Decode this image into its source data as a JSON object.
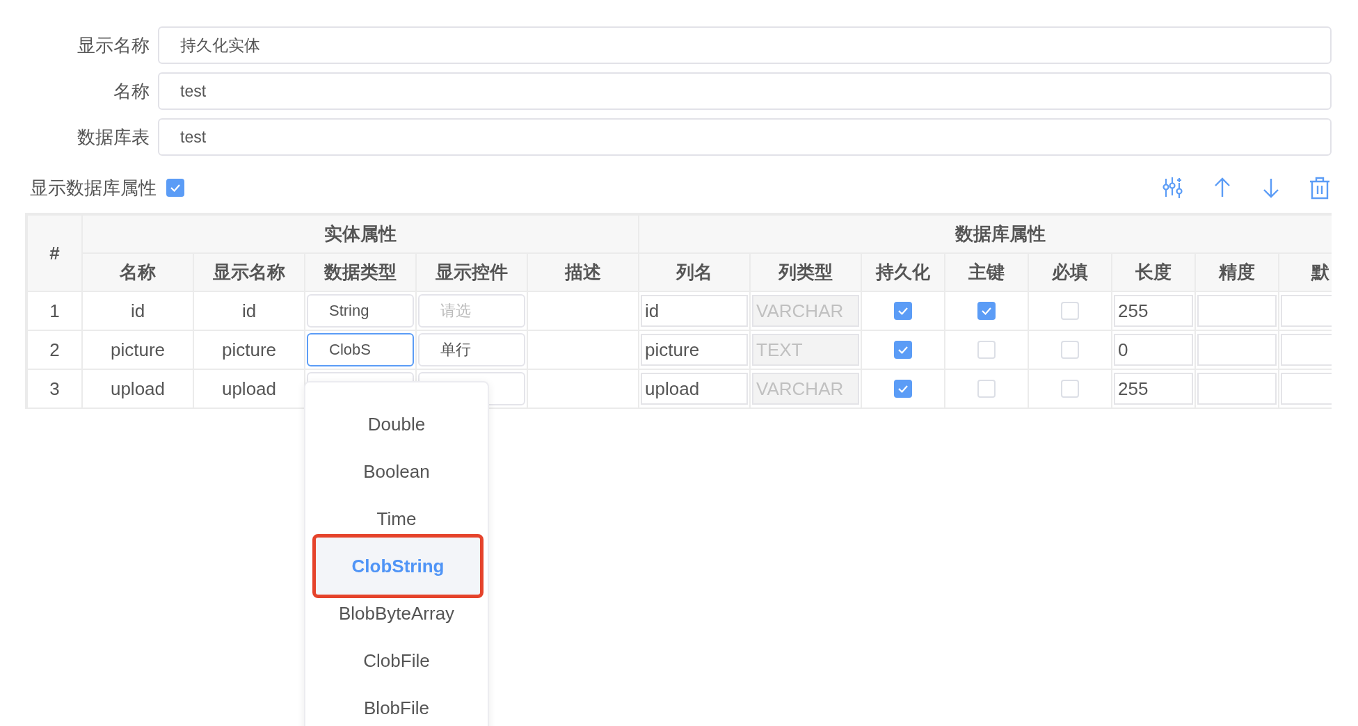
{
  "form": {
    "fields": [
      {
        "label": "显示名称",
        "value": "持久化实体"
      },
      {
        "label": "名称",
        "value": "test"
      },
      {
        "label": "数据库表",
        "value": "test"
      }
    ]
  },
  "show_db_toggle": {
    "label": "显示数据库属性",
    "checked": true
  },
  "toolbar": {
    "buttons": [
      {
        "kind": "sliders"
      },
      {
        "kind": "up"
      },
      {
        "kind": "down"
      },
      {
        "kind": "delete"
      }
    ]
  },
  "table": {
    "index_header": "#",
    "groups": [
      "实体属性",
      "数据库属性"
    ],
    "columns": [
      "名称",
      "显示名称",
      "数据类型",
      "显示控件",
      "描述",
      "列名",
      "列类型",
      "持久化",
      "主键",
      "必填",
      "长度",
      "精度",
      "默"
    ],
    "rows": [
      {
        "index": "1",
        "name": "id",
        "display_name": "id",
        "data_type": {
          "value": "String",
          "focused": false
        },
        "control": {
          "placeholder": "请选"
        },
        "column_name": "id",
        "column_type": "VARCHAR",
        "persistent": true,
        "primary_key": true,
        "required": false,
        "length": "255"
      },
      {
        "index": "2",
        "name": "picture",
        "display_name": "picture",
        "data_type": {
          "value": "ClobS",
          "focused": true
        },
        "control": {
          "value": "单行"
        },
        "column_name": "picture",
        "column_type": "TEXT",
        "persistent": true,
        "primary_key": false,
        "required": false,
        "length": "0"
      },
      {
        "index": "3",
        "name": "upload",
        "display_name": "upload",
        "column_name": "upload",
        "column_type": "VARCHAR",
        "persistent": true,
        "primary_key": false,
        "required": false,
        "length": "255"
      }
    ]
  },
  "dropdown": {
    "items": [
      {
        "label": "Double",
        "selected": false,
        "highlighted": false
      },
      {
        "label": "Boolean",
        "selected": false,
        "highlighted": false
      },
      {
        "label": "Time",
        "selected": false,
        "highlighted": false
      },
      {
        "label": "ClobString",
        "selected": true,
        "highlighted": true
      },
      {
        "label": "BlobByteArray",
        "selected": false,
        "highlighted": false
      },
      {
        "label": "ClobFile",
        "selected": false,
        "highlighted": false
      },
      {
        "label": "BlobFile",
        "selected": false,
        "highlighted": false
      }
    ]
  }
}
